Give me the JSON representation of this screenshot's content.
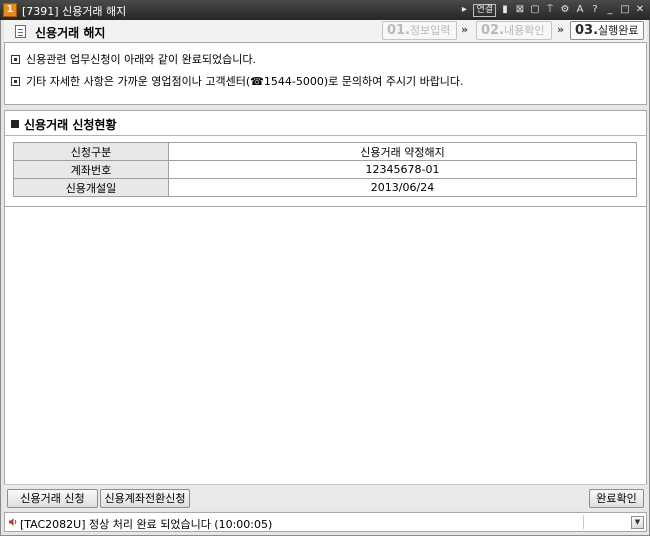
{
  "window": {
    "number": "1",
    "title": "[7391] 신용거래 해지",
    "controls": {
      "arrow_icon": "▸",
      "link": "연결",
      "pin_icon": "▮",
      "grid_icon": "⊠",
      "copy_icon": "▢",
      "top_icon": "⍑",
      "settings_icon": "⚙",
      "font": "A",
      "help": "?",
      "minimize": "_",
      "maximize": "□",
      "close": "✕"
    }
  },
  "header": {
    "page_title": "신용거래 해지",
    "steps": [
      {
        "num": "01.",
        "label": "정보입력"
      },
      {
        "num": "02.",
        "label": "내용확인"
      },
      {
        "num": "03.",
        "label": "실행완료"
      }
    ],
    "separator": "»"
  },
  "notice": {
    "lines": [
      "신용관련 업무신청이 아래와 같이 완료되었습니다.",
      "기타 자세한 사항은 가까운 영업점이나 고객센터(☎1544-5000)로 문의하여 주시기 바랍니다."
    ]
  },
  "status_section": {
    "title": "신용거래 신청현황",
    "rows": [
      {
        "label": "신청구분",
        "value": "신용거래 약정해지"
      },
      {
        "label": "계좌번호",
        "value": "12345678-01"
      },
      {
        "label": "신용개설일",
        "value": "2013/06/24"
      }
    ]
  },
  "buttons": {
    "credit_apply": "신용거래 신청",
    "credit_account_convert": "신용계좌전환신청",
    "confirm_complete": "완료확인"
  },
  "statusbar": {
    "message": "[TAC2082U] 정상 처리 완료 되었습니다 (10:00:05)",
    "dropdown_icon": "▼"
  },
  "colors": {
    "titlebar": "#2f2f2f",
    "window_number_badge": "#e88a1a",
    "label_cell_bg": "#e8e8e8"
  }
}
